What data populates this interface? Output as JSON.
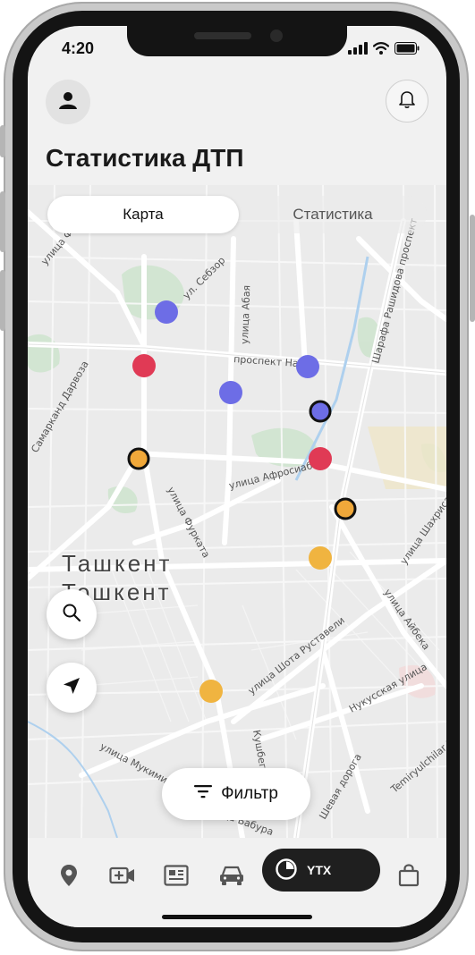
{
  "status_bar": {
    "time": "4:20"
  },
  "header": {
    "title": "Статистика ДТП"
  },
  "tabs": [
    {
      "label": "Карта",
      "active": true
    },
    {
      "label": "Статистика",
      "active": false
    }
  ],
  "map": {
    "city_label_ru": "Ташкент",
    "city_label_uz": "Тошкент",
    "street_labels": [
      "улица Фароби",
      "ул. Себзор",
      "улица Абая",
      "проспект Навои",
      "Шарафа Рашидова проспект",
      "Самарканд Дарвоза",
      "улица Фурката",
      "улица Афросиаб",
      "улица Шахрисабз",
      "улица Айбека",
      "улица Шота Руставели",
      "Нукусская улица",
      "Temiryulchilar St",
      "улица Мукими",
      "улица Бабура",
      "Кушбеги",
      "Шевая дорога"
    ],
    "markers": [
      {
        "color": "#6d6de6",
        "outlined": false
      },
      {
        "color": "#e03a55",
        "outlined": false
      },
      {
        "color": "#6d6de6",
        "outlined": false
      },
      {
        "color": "#6d6de6",
        "outlined": false
      },
      {
        "color": "#6d6de6",
        "outlined": true
      },
      {
        "color": "#f0a83a",
        "outlined": true
      },
      {
        "color": "#e03a55",
        "outlined": false
      },
      {
        "color": "#f0a83a",
        "outlined": true
      },
      {
        "color": "#f0b440",
        "outlined": false
      },
      {
        "color": "#f0b440",
        "outlined": false
      }
    ]
  },
  "filter": {
    "label": "Фильтр"
  },
  "bottom_nav": {
    "items": [
      {
        "icon": "location-pin-icon"
      },
      {
        "icon": "video-add-icon"
      },
      {
        "icon": "news-icon"
      },
      {
        "icon": "car-icon"
      },
      {
        "icon": "bag-icon"
      }
    ],
    "active": {
      "icon": "pie-chart-icon",
      "label": "YTX"
    }
  },
  "colors": {
    "accent_dark": "#1f1f1f",
    "marker_blue": "#6d6de6",
    "marker_red": "#e03a55",
    "marker_orange": "#f0a83a"
  }
}
